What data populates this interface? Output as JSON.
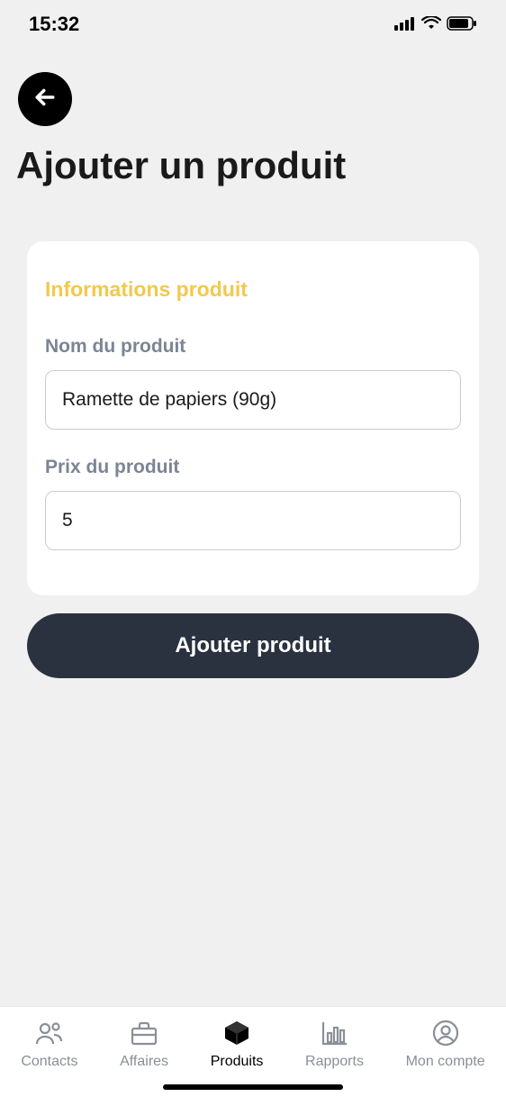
{
  "status_bar": {
    "time": "15:32"
  },
  "page": {
    "title": "Ajouter un produit"
  },
  "form": {
    "section_title": "Informations produit",
    "name_label": "Nom du produit",
    "name_value": "Ramette de papiers (90g)",
    "price_label": "Prix du produit",
    "price_value": "5",
    "submit_label": "Ajouter produit"
  },
  "tabs": {
    "contacts_label": "Contacts",
    "deals_label": "Affaires",
    "products_label": "Produits",
    "reports_label": "Rapports",
    "account_label": "Mon compte"
  }
}
